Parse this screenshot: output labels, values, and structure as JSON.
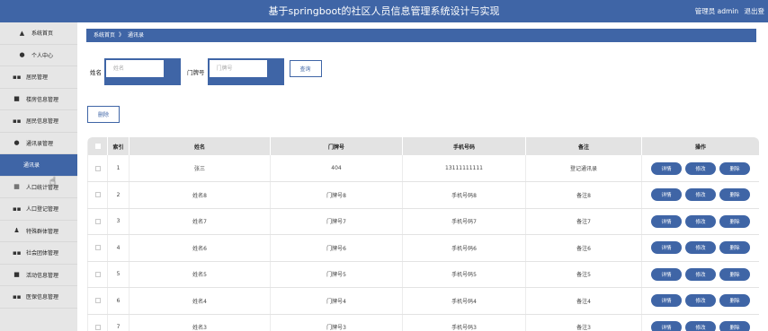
{
  "header": {
    "title": "基于springboot的社区人员信息管理系统设计与实现",
    "user_role": "管理员 admin",
    "logout": "退出登"
  },
  "sidebar": {
    "items": [
      {
        "label": "系统首页",
        "icon": "home-icon",
        "glyph": "▲"
      },
      {
        "label": "个人中心",
        "icon": "person-icon",
        "glyph": "●"
      },
      {
        "label": "居民管理",
        "icon": "grid-icon",
        "glyph": "▪▪"
      },
      {
        "label": "楼房信息管理",
        "icon": "building-icon",
        "glyph": "■"
      },
      {
        "label": "居民信息管理",
        "icon": "grid-icon",
        "glyph": "▪▪"
      },
      {
        "label": "通讯录管理",
        "icon": "pin-icon",
        "glyph": "●"
      },
      {
        "label": "通讯录",
        "icon": "",
        "glyph": ""
      },
      {
        "label": "人口统计管理",
        "icon": "table-icon",
        "glyph": "▦"
      },
      {
        "label": "人口登记管理",
        "icon": "grid-icon",
        "glyph": "▪▪"
      },
      {
        "label": "特殊群体管理",
        "icon": "person-icon",
        "glyph": "♟"
      },
      {
        "label": "社会团体管理",
        "icon": "grid-icon",
        "glyph": "▪▪"
      },
      {
        "label": "活动信息管理",
        "icon": "lock-icon",
        "glyph": "■"
      },
      {
        "label": "医保信息管理",
        "icon": "grid-icon",
        "glyph": "▪▪"
      }
    ]
  },
  "breadcrumb": {
    "home": "系统首页",
    "separator": "》",
    "current": "通讯录"
  },
  "search": {
    "name_label": "姓名",
    "name_placeholder": "姓名",
    "door_label": "门牌号",
    "door_placeholder": "门牌号",
    "button": "查询"
  },
  "delete_button": "删除",
  "table": {
    "headers": [
      "",
      "索引",
      "姓名",
      "门牌号",
      "手机号码",
      "备注",
      "操作"
    ],
    "rows": [
      {
        "index": "1",
        "name": "张三",
        "door": "404",
        "phone": "13111111111",
        "note": "登记通讯录"
      },
      {
        "index": "2",
        "name": "姓名8",
        "door": "门牌号8",
        "phone": "手机号码8",
        "note": "备注8"
      },
      {
        "index": "3",
        "name": "姓名7",
        "door": "门牌号7",
        "phone": "手机号码7",
        "note": "备注7"
      },
      {
        "index": "4",
        "name": "姓名6",
        "door": "门牌号6",
        "phone": "手机号码6",
        "note": "备注6"
      },
      {
        "index": "5",
        "name": "姓名5",
        "door": "门牌号5",
        "phone": "手机号码5",
        "note": "备注5"
      },
      {
        "index": "6",
        "name": "姓名4",
        "door": "门牌号4",
        "phone": "手机号码4",
        "note": "备注4"
      },
      {
        "index": "7",
        "name": "姓名3",
        "door": "门牌号3",
        "phone": "手机号码3",
        "note": "备注3"
      }
    ],
    "actions": {
      "detail": "详情",
      "edit": "修改",
      "delete": "删除"
    }
  },
  "colors": {
    "accent": "#3f65a6",
    "sidebar_bg": "#e6e6e6",
    "header_row": "#e3e3e3"
  }
}
